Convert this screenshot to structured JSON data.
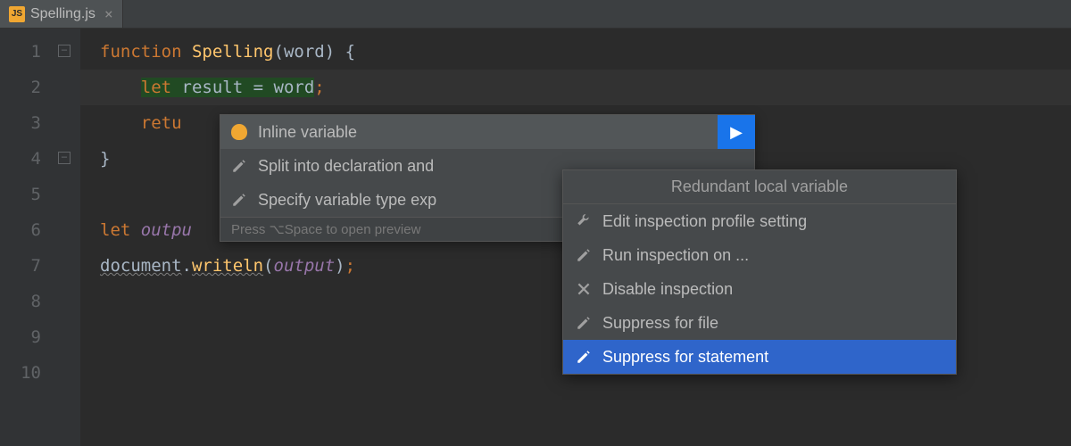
{
  "tab": {
    "icon_text": "JS",
    "label": "Spelling.js",
    "close": "×"
  },
  "gutter": [
    "1",
    "2",
    "3",
    "4",
    "5",
    "6",
    "7",
    "8",
    "9",
    "10"
  ],
  "code": {
    "l1": {
      "kw": "function",
      "fn": "Spelling",
      "paren_open": "(",
      "param": "word",
      "paren_close": ")",
      "brace": " {"
    },
    "l2": {
      "indent": "    ",
      "kw": "let",
      "sp": " ",
      "var": "result",
      "eq": " = ",
      "rhs": "word",
      "semi": ";"
    },
    "l3": {
      "indent": "    ",
      "kw": "retu"
    },
    "l4": {
      "brace": "}"
    },
    "l6": {
      "kw": "let",
      "sp": " ",
      "var": "outpu"
    },
    "l7": {
      "obj": "document",
      "dot": ".",
      "method": "writeln",
      "po": "(",
      "arg": "output",
      "pc": ")",
      "semi": ";"
    }
  },
  "popup1": {
    "items": [
      "Inline variable",
      "Split into declaration and",
      "Specify variable type exp"
    ],
    "hint": "Press ⌥Space to open preview",
    "arrow": "▶"
  },
  "popup2": {
    "header": "Redundant local variable",
    "items": [
      "Edit inspection profile setting",
      "Run inspection on ...",
      "Disable inspection",
      "Suppress for file",
      "Suppress for statement"
    ]
  }
}
